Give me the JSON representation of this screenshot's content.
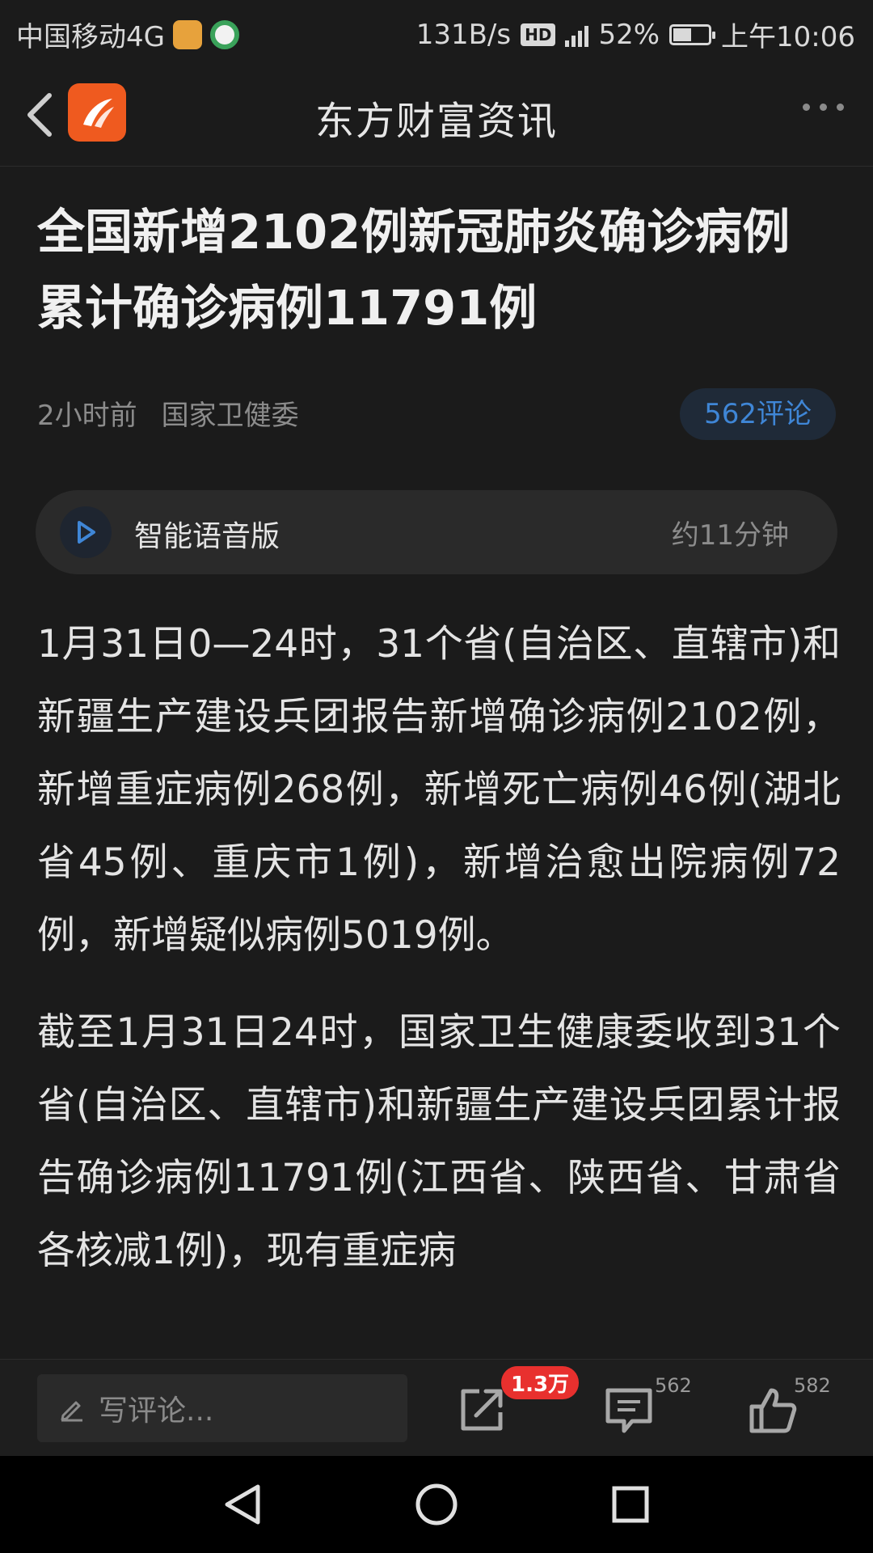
{
  "status_bar": {
    "carrier": "中国移动4G",
    "net_speed": "131B/s",
    "hd": "HD",
    "battery": "52%",
    "battery_level": 0.52,
    "time": "上午10:06"
  },
  "nav": {
    "title": "东方财富资讯"
  },
  "article": {
    "headline": "全国新增2102例新冠肺炎确诊病例 累计确诊病例11791例",
    "time_ago": "2小时前",
    "source": "国家卫健委",
    "comments_pill": "562评论",
    "audio_label": "智能语音版",
    "audio_duration": "约11分钟",
    "paragraphs": [
      "1月31日0—24时，31个省(自治区、直辖市)和新疆生产建设兵团报告新增确诊病例2102例，新增重症病例268例，新增死亡病例46例(湖北省45例、重庆市1例)，新增治愈出院病例72例，新增疑似病例5019例。",
      "截至1月31日24时，国家卫生健康委收到31个省(自治区、直辖市)和新疆生产建设兵团累计报告确诊病例11791例(江西省、陕西省、甘肃省各核减1例)，现有重症病"
    ]
  },
  "action_bar": {
    "comment_placeholder": "写评论...",
    "share_badge": "1.3万",
    "comment_count": "562",
    "like_count": "582"
  }
}
